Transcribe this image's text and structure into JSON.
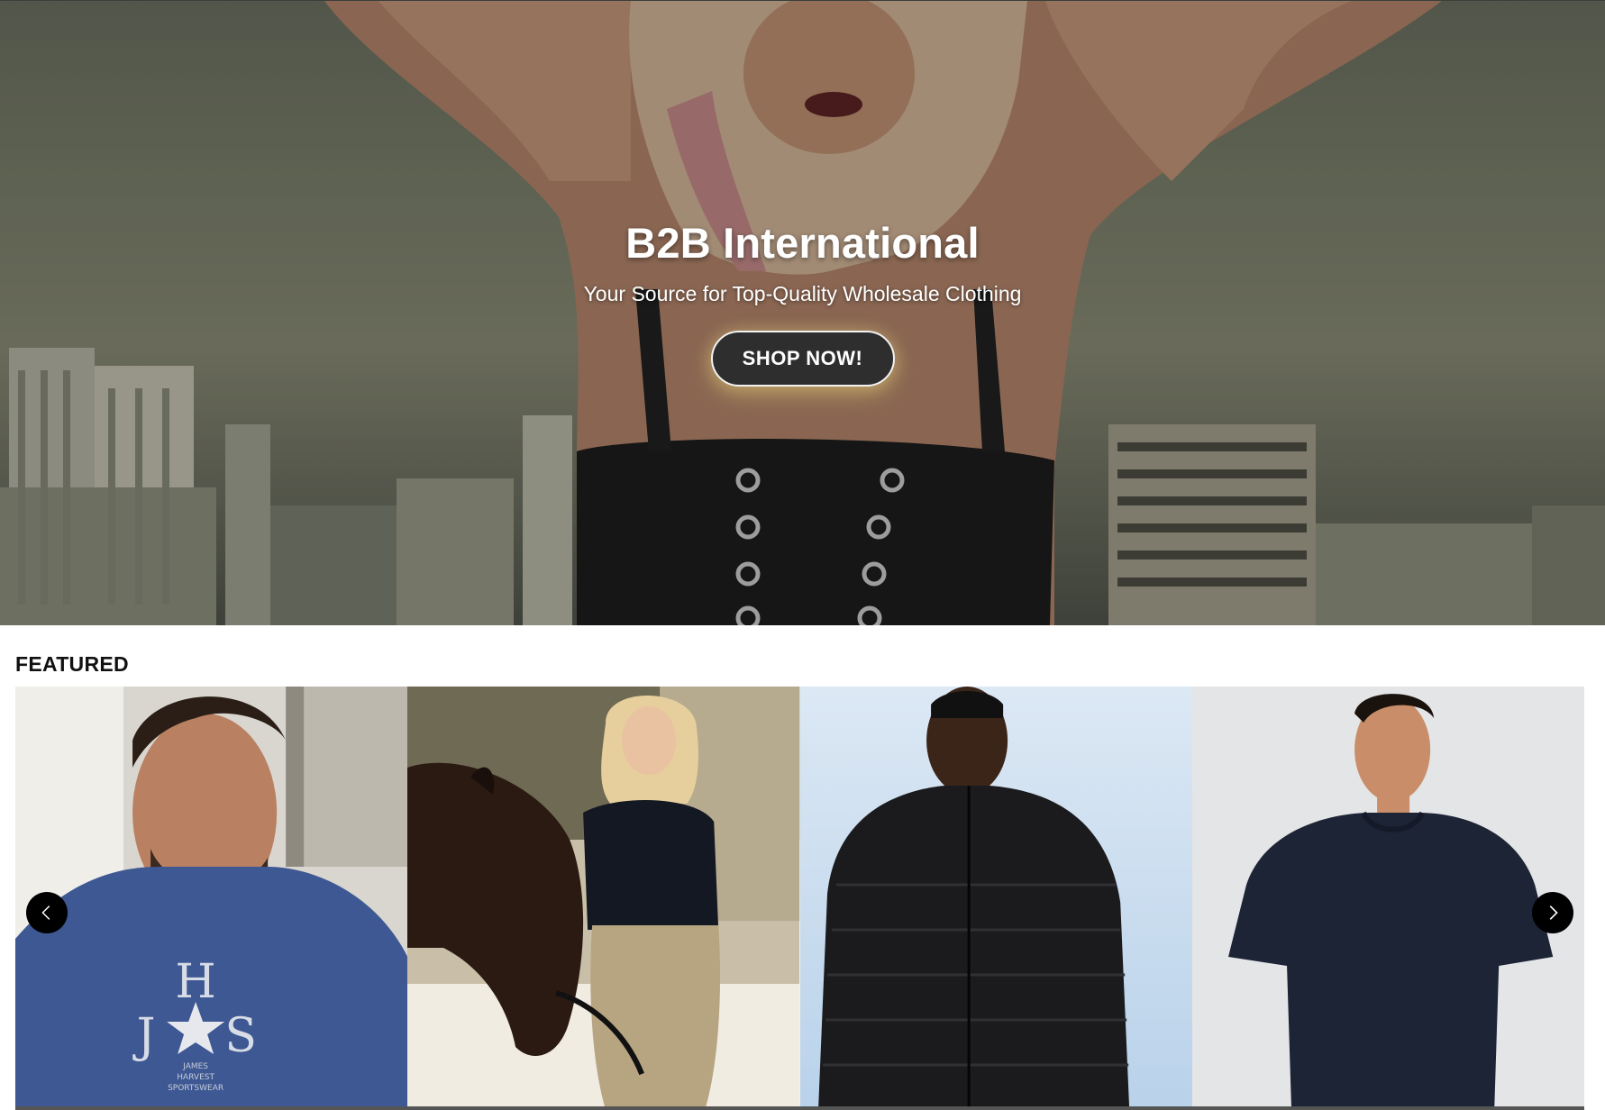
{
  "hero": {
    "title": "B2B International",
    "subtitle": "Your Source for Top-Quality Wholesale Clothing",
    "cta_label": "SHOP NOW!",
    "image": "model-in-black-corset-city-skyline"
  },
  "featured": {
    "heading": "FEATURED",
    "products": [
      {
        "image": "man-in-navy-tee-hjs-print",
        "print_letters": "H J S",
        "print_text": "JAMES HARVEST SPORTSWEAR"
      },
      {
        "image": "woman-in-black-polo-with-horse"
      },
      {
        "image": "man-in-black-puffer-jacket"
      },
      {
        "image": "man-in-navy-crew-tee"
      }
    ],
    "prev_icon": "chevron-left-icon",
    "next_icon": "chevron-right-icon"
  },
  "colors": {
    "cta_bg": "#2e2e2e",
    "arrow_bg": "#000000",
    "heading": "#111111"
  }
}
